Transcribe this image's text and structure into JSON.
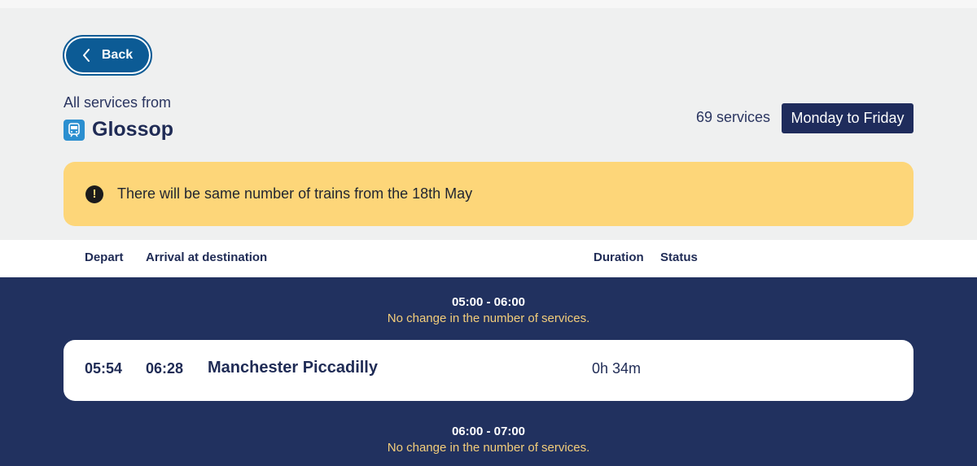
{
  "back_label": "Back",
  "header": {
    "subtitle": "All services from",
    "station": "Glossop",
    "service_count": "69 services",
    "day_filter": "Monday to Friday"
  },
  "notice": {
    "message": "There will be same number of trains from the 18th May"
  },
  "columns": {
    "depart": "Depart",
    "arrival": "Arrival at destination",
    "duration": "Duration",
    "status": "Status"
  },
  "groups": [
    {
      "hours": "05:00 - 06:00",
      "change": "No change in the number of services.",
      "services": [
        {
          "depart": "05:54",
          "arrive": "06:28",
          "destination": "Manchester Piccadilly",
          "duration": "0h 34m",
          "status": ""
        }
      ]
    },
    {
      "hours": "06:00 - 07:00",
      "change": "No change in the number of services."
    }
  ],
  "colors": {
    "accent": "#0c5b95",
    "navy": "#21315f",
    "notice": "#fdd679",
    "change_text": "#f3cd7a"
  },
  "icons": [
    "chevron-left-icon",
    "train-icon",
    "alert-icon"
  ]
}
